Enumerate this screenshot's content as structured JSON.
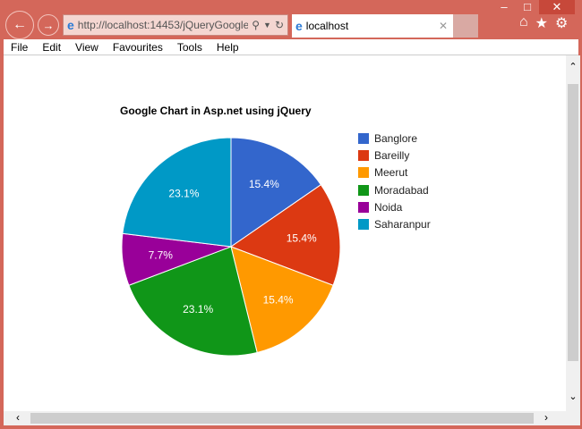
{
  "browser": {
    "address": "http://localhost:14453/jQueryGoogle",
    "address_host": "localhost",
    "tab_title": "localhost"
  },
  "menu": [
    "File",
    "Edit",
    "View",
    "Favourites",
    "Tools",
    "Help"
  ],
  "chart_data": {
    "type": "pie",
    "title": "Google Chart in Asp.net using jQuery",
    "categories": [
      "Banglore",
      "Bareilly",
      "Meerut",
      "Moradabad",
      "Noida",
      "Saharanpur"
    ],
    "values": [
      2,
      2,
      2,
      3,
      1,
      3
    ],
    "labels": [
      "15.4%",
      "15.4%",
      "15.4%",
      "23.1%",
      "7.7%",
      "23.1%"
    ],
    "colors": [
      "#3366cc",
      "#dc3912",
      "#ff9900",
      "#109618",
      "#990099",
      "#0099c6"
    ],
    "legend": "right"
  }
}
